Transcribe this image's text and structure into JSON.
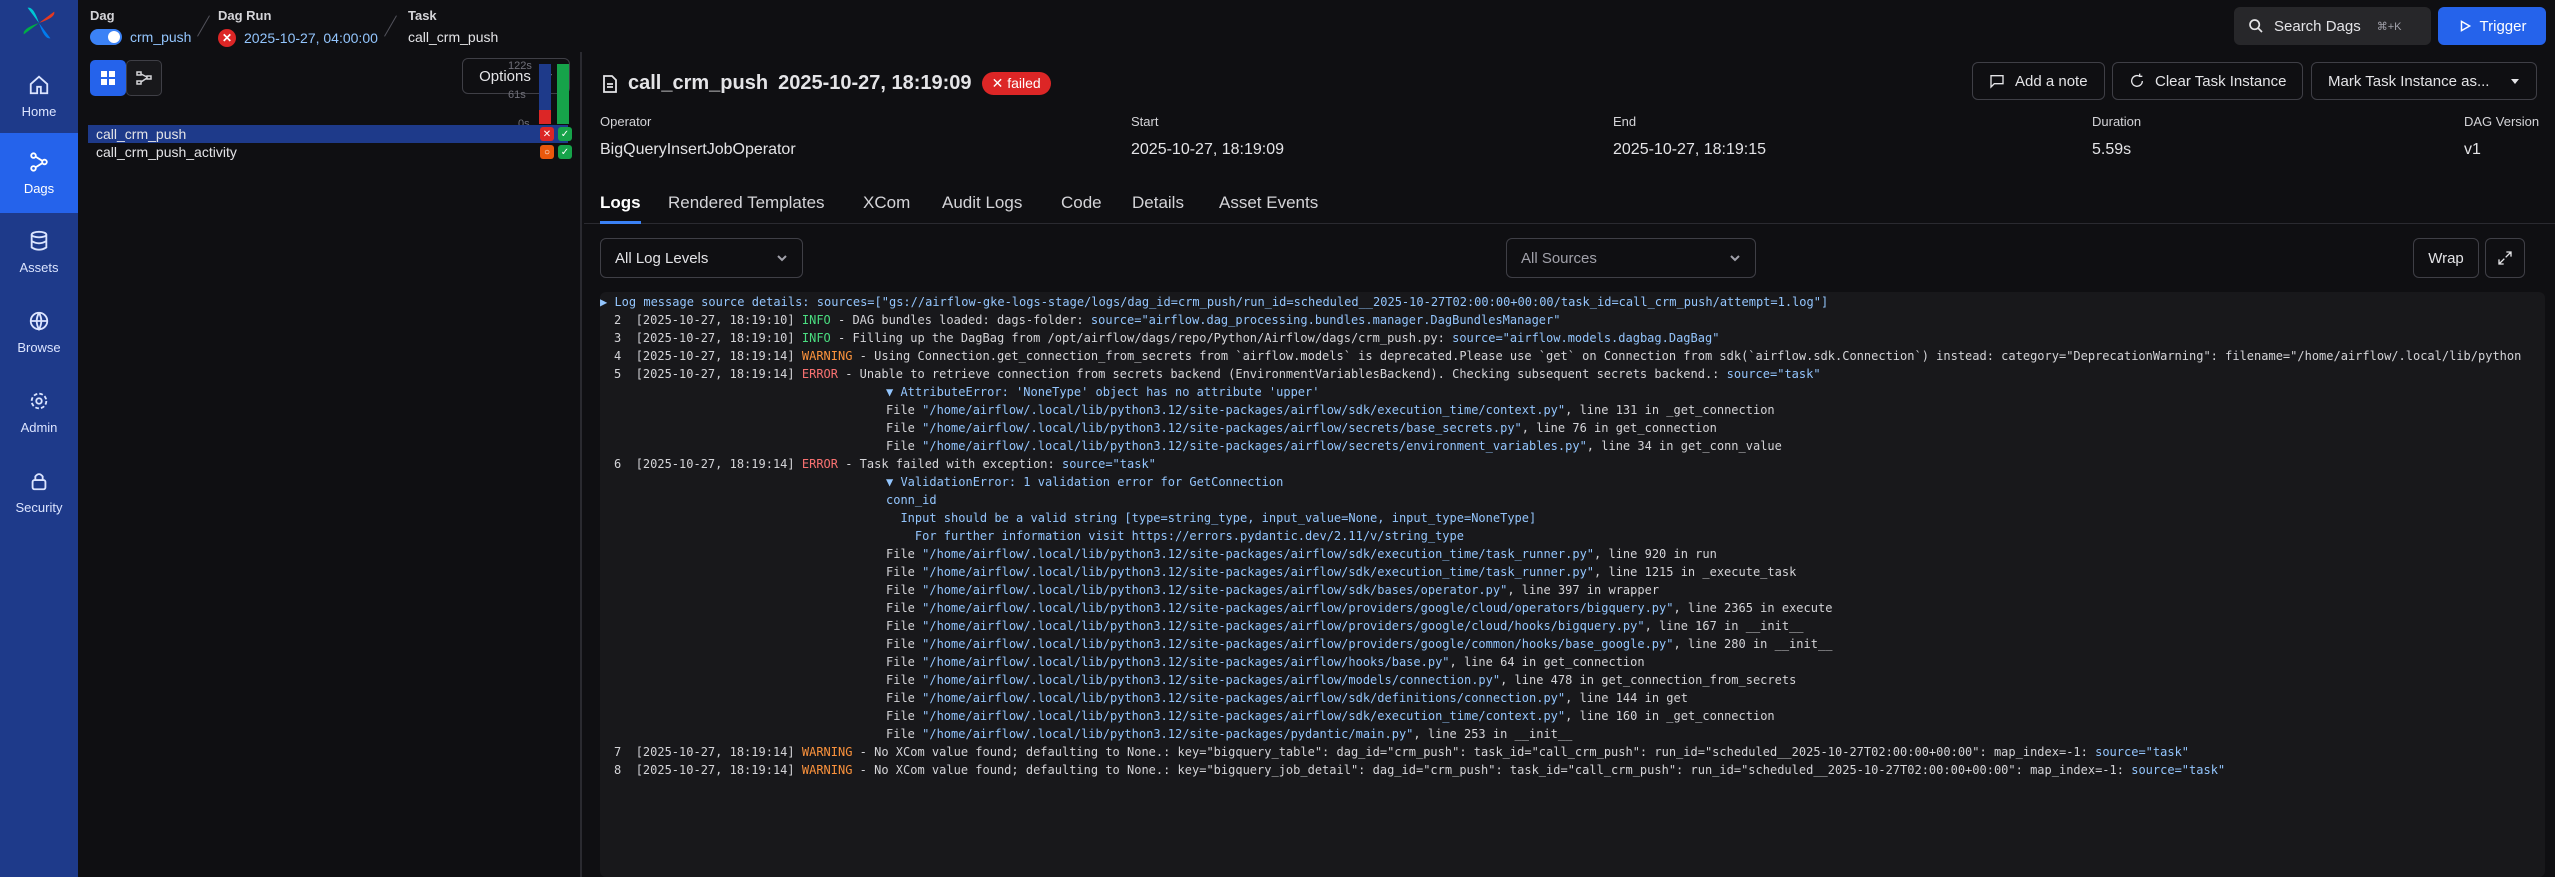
{
  "nav": {
    "items": [
      {
        "label": "Home",
        "icon": "home-icon"
      },
      {
        "label": "Dags",
        "icon": "dags-icon",
        "active": true
      },
      {
        "label": "Assets",
        "icon": "database-icon"
      },
      {
        "label": "Browse",
        "icon": "globe-icon"
      },
      {
        "label": "Admin",
        "icon": "gear-icon"
      },
      {
        "label": "Security",
        "icon": "lock-icon"
      }
    ]
  },
  "breadcrumb": {
    "dag_label": "Dag",
    "dag_value": "crm_push",
    "run_label": "Dag Run",
    "run_value": "2025-10-27, 04:00:00",
    "task_label": "Task",
    "task_value": "call_crm_push"
  },
  "header": {
    "search_label": "Search Dags",
    "search_shortcut": "⌘+K",
    "trigger_label": "Trigger"
  },
  "left": {
    "options_label": "Options",
    "bar_labels": [
      "122s",
      "61s",
      "0s"
    ],
    "tasks": [
      {
        "name": "call_crm_push",
        "selected": true
      },
      {
        "name": "call_crm_push_activity",
        "selected": false
      }
    ]
  },
  "task_instance": {
    "name": "call_crm_push",
    "timestamp": "2025-10-27, 18:19:09",
    "state": "failed",
    "add_note": "Add a note",
    "clear": "Clear Task Instance",
    "mark": "Mark Task Instance as...",
    "meta": [
      {
        "key": "Operator",
        "value": "BigQueryInsertJobOperator"
      },
      {
        "key": "Start",
        "value": "2025-10-27, 18:19:09"
      },
      {
        "key": "End",
        "value": "2025-10-27, 18:19:15"
      },
      {
        "key": "Duration",
        "value": "5.59s"
      },
      {
        "key": "DAG Version",
        "value": "v1"
      }
    ]
  },
  "tabs": [
    "Logs",
    "Rendered Templates",
    "XCom",
    "Audit Logs",
    "Code",
    "Details",
    "Asset Events"
  ],
  "logs": {
    "level_filter": "All Log Levels",
    "source_filter": "All Sources",
    "wrap_label": "Wrap",
    "source_details": "▶ Log message source details: sources=[\"gs://airflow-gke-logs-stage/logs/dag_id=crm_push/run_id=scheduled__2025-10-27T02:00:00+00:00/task_id=call_crm_push/attempt=1.log\"]",
    "lines": [
      {
        "n": "2",
        "ts": "[2025-10-27, 18:19:10]",
        "lvl": "INFO",
        "msg": " - DAG bundles loaded: dags-folder: ",
        "src": "source=\"airflow.dag_processing.bundles.manager.DagBundlesManager\""
      },
      {
        "n": "3",
        "ts": "[2025-10-27, 18:19:10]",
        "lvl": "INFO",
        "msg": " - Filling up the DagBag from /opt/airflow/dags/repo/Python/Airflow/dags/crm_push.py: ",
        "src": "source=\"airflow.models.dagbag.DagBag\""
      },
      {
        "n": "4",
        "ts": "[2025-10-27, 18:19:14]",
        "lvl": "WARNING",
        "msg": " - Using Connection.get_connection_from_secrets from `airflow.models` is deprecated.Please use `get` on Connection from sdk(`airflow.sdk.Connection`) instead: category=\"DeprecationWarning\": filename=\"/home/airflow/.local/lib/python",
        "src": ""
      },
      {
        "n": "5",
        "ts": "[2025-10-27, 18:19:14]",
        "lvl": "ERROR",
        "msg": " - Unable to retrieve connection from secrets backend (EnvironmentVariablesBackend). Checking subsequent secrets backend.: ",
        "src": "source=\"task\""
      },
      {
        "n": "6",
        "ts": "[2025-10-27, 18:19:14]",
        "lvl": "ERROR",
        "msg": " - Task failed with exception: ",
        "src": "source=\"task\""
      },
      {
        "n": "7",
        "ts": "[2025-10-27, 18:19:14]",
        "lvl": "WARNING",
        "msg": " - No XCom value found; defaulting to None.: key=\"bigquery_table\": dag_id=\"crm_push\": task_id=\"call_crm_push\": run_id=\"scheduled__2025-10-27T02:00:00+00:00\": map_index=-1: ",
        "src": "source=\"task\""
      },
      {
        "n": "8",
        "ts": "[2025-10-27, 18:19:14]",
        "lvl": "WARNING",
        "msg": " - No XCom value found; defaulting to None.: key=\"bigquery_job_detail\": dag_id=\"crm_push\": task_id=\"call_crm_push\": run_id=\"scheduled__2025-10-27T02:00:00+00:00\": map_index=-1: ",
        "src": "source=\"task\""
      }
    ],
    "trace1_header": "▼ AttributeError: 'NoneType' object has no attribute 'upper'",
    "trace1": [
      {
        "path": "\"/home/airflow/.local/lib/python3.12/site-packages/airflow/sdk/execution_time/context.py\"",
        "tail": ", line 131 in _get_connection"
      },
      {
        "path": "\"/home/airflow/.local/lib/python3.12/site-packages/airflow/secrets/base_secrets.py\"",
        "tail": ", line 76 in get_connection"
      },
      {
        "path": "\"/home/airflow/.local/lib/python3.12/site-packages/airflow/secrets/environment_variables.py\"",
        "tail": ", line 34 in get_conn_value"
      }
    ],
    "trace2_header": "▼ ValidationError: 1 validation error for GetConnection",
    "trace2_detail": [
      "conn_id",
      "  Input should be a valid string [type=string_type, input_value=None, input_type=NoneType]",
      "    For further information visit https://errors.pydantic.dev/2.11/v/string_type"
    ],
    "trace2": [
      {
        "path": "\"/home/airflow/.local/lib/python3.12/site-packages/airflow/sdk/execution_time/task_runner.py\"",
        "tail": ", line 920 in run"
      },
      {
        "path": "\"/home/airflow/.local/lib/python3.12/site-packages/airflow/sdk/execution_time/task_runner.py\"",
        "tail": ", line 1215 in _execute_task"
      },
      {
        "path": "\"/home/airflow/.local/lib/python3.12/site-packages/airflow/sdk/bases/operator.py\"",
        "tail": ", line 397 in wrapper"
      },
      {
        "path": "\"/home/airflow/.local/lib/python3.12/site-packages/airflow/providers/google/cloud/operators/bigquery.py\"",
        "tail": ", line 2365 in execute"
      },
      {
        "path": "\"/home/airflow/.local/lib/python3.12/site-packages/airflow/providers/google/cloud/hooks/bigquery.py\"",
        "tail": ", line 167 in __init__"
      },
      {
        "path": "\"/home/airflow/.local/lib/python3.12/site-packages/airflow/providers/google/common/hooks/base_google.py\"",
        "tail": ", line 280 in __init__"
      },
      {
        "path": "\"/home/airflow/.local/lib/python3.12/site-packages/airflow/hooks/base.py\"",
        "tail": ", line 64 in get_connection"
      },
      {
        "path": "\"/home/airflow/.local/lib/python3.12/site-packages/airflow/models/connection.py\"",
        "tail": ", line 478 in get_connection_from_secrets"
      },
      {
        "path": "\"/home/airflow/.local/lib/python3.12/site-packages/airflow/sdk/definitions/connection.py\"",
        "tail": ", line 144 in get"
      },
      {
        "path": "\"/home/airflow/.local/lib/python3.12/site-packages/airflow/sdk/execution_time/context.py\"",
        "tail": ", line 160 in _get_connection"
      },
      {
        "path": "\"/home/airflow/.local/lib/python3.12/site-packages/pydantic/main.py\"",
        "tail": ", line 253 in __init__"
      }
    ],
    "file_word": "File "
  }
}
